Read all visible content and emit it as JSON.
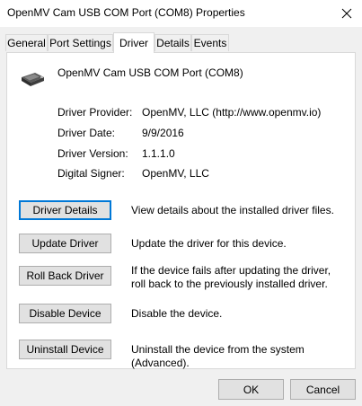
{
  "window": {
    "title": "OpenMV Cam USB COM Port (COM8) Properties"
  },
  "tabs": [
    {
      "label": "General",
      "active": false
    },
    {
      "label": "Port Settings",
      "active": false
    },
    {
      "label": "Driver",
      "active": true
    },
    {
      "label": "Details",
      "active": false
    },
    {
      "label": "Events",
      "active": false
    }
  ],
  "device": {
    "name": "OpenMV Cam USB COM Port (COM8)",
    "icon": "usb-device-icon"
  },
  "properties": [
    {
      "label": "Driver Provider:",
      "value": "OpenMV, LLC (http://www.openmv.io)"
    },
    {
      "label": "Driver Date:",
      "value": "9/9/2016"
    },
    {
      "label": "Driver Version:",
      "value": "1.1.1.0"
    },
    {
      "label": "Digital Signer:",
      "value": "OpenMV, LLC"
    }
  ],
  "actions": [
    {
      "label": "Driver Details",
      "description": "View details about the installed driver files."
    },
    {
      "label": "Update Driver",
      "description": "Update the driver for this device."
    },
    {
      "label": "Roll Back Driver",
      "description": "If the device fails after updating the driver, roll back to the previously installed driver."
    },
    {
      "label": "Disable Device",
      "description": "Disable the device."
    },
    {
      "label": "Uninstall Device",
      "description": "Uninstall the device from the system (Advanced)."
    }
  ],
  "footer": {
    "ok_label": "OK",
    "cancel_label": "Cancel"
  },
  "colors": {
    "focus_border": "#0078d7",
    "button_face": "#e1e1e1",
    "dialog_background": "#f0f0f0"
  }
}
